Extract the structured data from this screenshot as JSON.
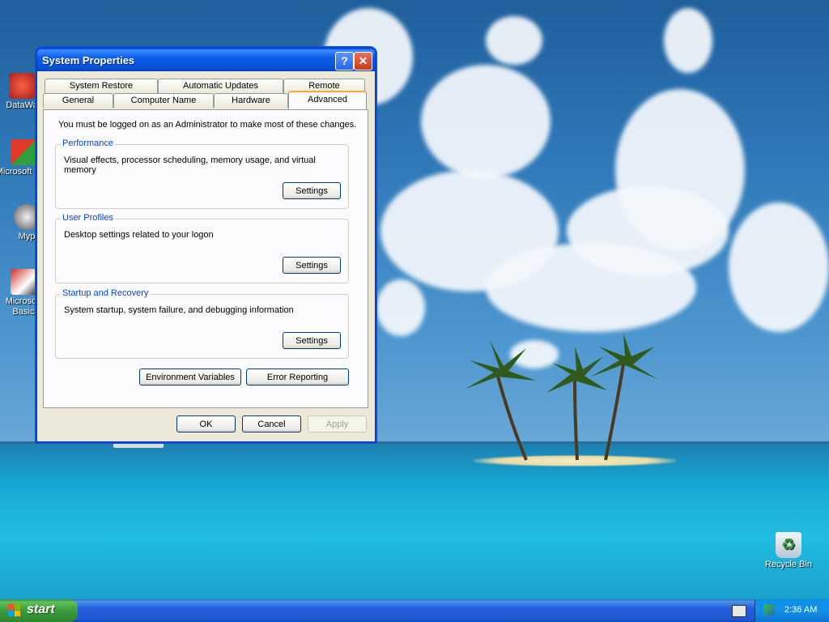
{
  "desktop": {
    "icons": [
      {
        "label": "DataWa"
      },
      {
        "label": "Microsoft C++"
      },
      {
        "label": "Myp"
      },
      {
        "label": "Microsoft Basic"
      },
      {
        "label": "Recycle Bin"
      }
    ]
  },
  "window": {
    "title": "System Properties",
    "tabs_row1": [
      "System Restore",
      "Automatic Updates",
      "Remote"
    ],
    "tabs_row2": [
      "General",
      "Computer Name",
      "Hardware",
      "Advanced"
    ],
    "active_tab": "Advanced",
    "intro": "You must be logged on as an Administrator to make most of these changes.",
    "groups": [
      {
        "title": "Performance",
        "desc": "Visual effects, processor scheduling, memory usage, and virtual memory",
        "button": "Settings"
      },
      {
        "title": "User Profiles",
        "desc": "Desktop settings related to your logon",
        "button": "Settings"
      },
      {
        "title": "Startup and Recovery",
        "desc": "System startup, system failure, and debugging information",
        "button": "Settings"
      }
    ],
    "env_button": "Environment Variables",
    "error_button": "Error Reporting",
    "ok_button": "OK",
    "cancel_button": "Cancel",
    "apply_button": "Apply"
  },
  "taskbar": {
    "start_label": "start",
    "clock": "2:36 AM"
  },
  "colors": {
    "titlebar": "#0a5bef",
    "group_title": "#0046d5",
    "start_green": "#3a9a3a",
    "taskbar_blue": "#245edb"
  }
}
